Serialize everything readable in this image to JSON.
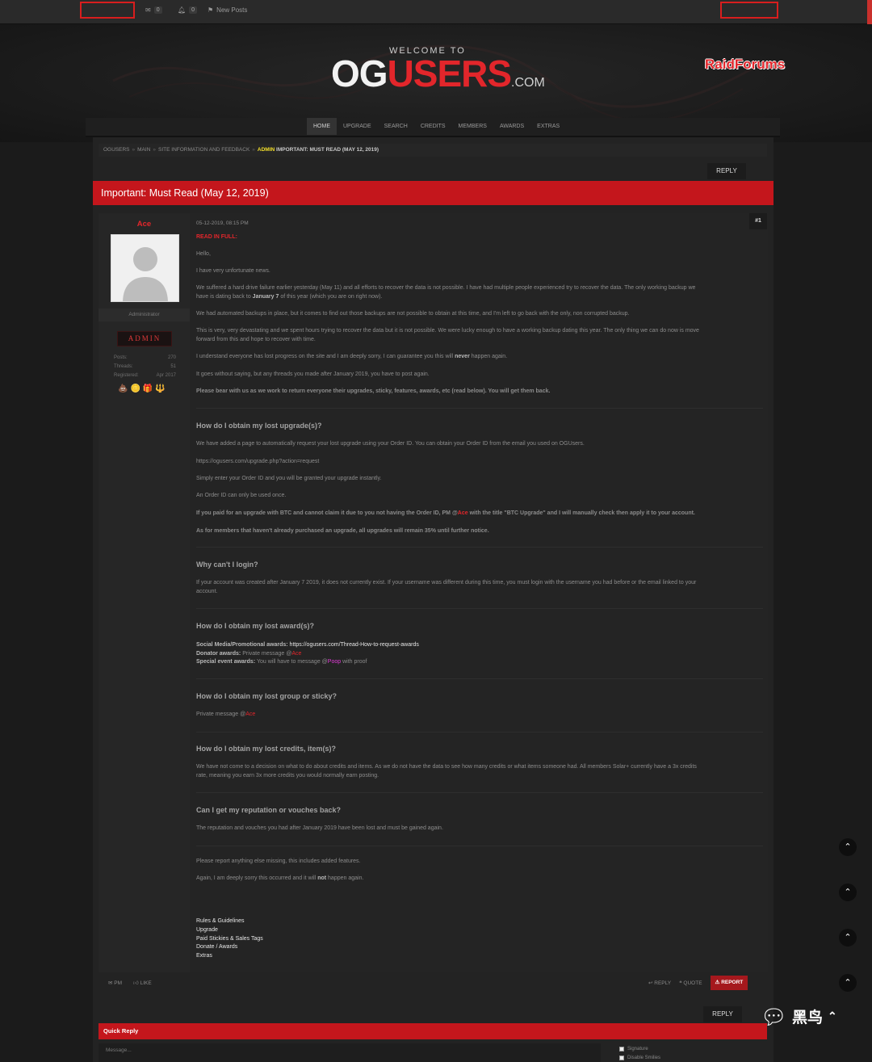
{
  "topbar": {
    "messages_count": "0",
    "alerts_count": "0",
    "new_posts": "New Posts"
  },
  "header": {
    "welcome": "WELCOME TO",
    "logo_og": "OG",
    "logo_users": "USERS",
    "logo_com": ".COM",
    "raidforums": "RaidForums"
  },
  "nav": [
    "HOME",
    "UPGRADE",
    "SEARCH",
    "CREDITS",
    "MEMBERS",
    "AWARDS",
    "EXTRAS"
  ],
  "breadcrumb": {
    "items": [
      "OGUSERS",
      "MAIN",
      "SITE INFORMATION AND FEEDBACK"
    ],
    "admin_tag": "ADMIN",
    "current": "IMPORTANT: MUST READ (MAY 12, 2019)"
  },
  "reply_label": "REPLY",
  "thread_title": "Important: Must Read (May 12, 2019)",
  "user": {
    "name": "Ace",
    "role": "Administrator",
    "badge": "ADMIN",
    "stats": [
      {
        "label": "Posts:",
        "value": "270"
      },
      {
        "label": "Threads:",
        "value": "51"
      },
      {
        "label": "Registered:",
        "value": "Apr 2017"
      }
    ],
    "awards": [
      "💩",
      "🪙",
      "🎁",
      "🔱"
    ]
  },
  "post": {
    "date": "05-12-2019, 08:15 PM",
    "number": "#1",
    "read_full": "READ IN FULL:",
    "p_hello": "Hello,",
    "p_news": "I have very unfortunate news.",
    "p_drive_1": "We suffered a hard drive failure earlier yesterday (May 11) and all efforts to recover the data is not possible. I have had multiple people experienced try to recover the data. The only working backup we",
    "p_drive_2a": "have is dating back to",
    "p_drive_2b": "January 7",
    "p_drive_2c": "of this year (which you are on right now).",
    "p_backups": "We had automated backups in place, but it comes to find out those backups are not possible to obtain at this time, and I'm left to go back with the only, non corrupted backup.",
    "p_devastating_1": "This is very, very devastating and we spent hours trying to recover the data but it is not possible. We were lucky enough to have a working backup dating this year. The only thing we can do now is move",
    "p_devastating_2": "forward from this and hope to recover with time.",
    "p_sorry_a": "I understand everyone has lost progress on the site and I am deeply sorry, I can guarantee you this will",
    "p_sorry_b": "never",
    "p_sorry_c": "happen again.",
    "p_threads": "It goes without saying, but any threads you made after January 2019, you have to post again.",
    "p_bear": "Please bear with us as we work to return everyone their upgrades, sticky, features, awards, etc (read below). You will get them back.",
    "h_upgrade": "How do I obtain my lost upgrade(s)?",
    "p_upgrade_page": "We have added a page to automatically request your lost upgrade using your Order ID. You can obtain your Order ID from the email you used on OGUsers.",
    "p_upgrade_url": "https://ogusers.com/upgrade.php?action=request",
    "p_enter_order": "Simply enter your Order ID and you will be granted your upgrade instantly.",
    "p_order_once": "An Order ID can only be used once.",
    "p_btc_a": "If you paid for an upgrade with BTC and cannot claim it due to you not having the Order ID, PM @",
    "p_btc_user": "Ace",
    "p_btc_b": "with the title \"BTC Upgrade\" and I will manually check then apply it to your account.",
    "p_discount": "As for members that haven't already purchased an upgrade, all upgrades will remain 35% until further notice.",
    "h_login": "Why can't I login?",
    "p_login_1": "If your account was created after January 7 2019, it does not currently exist. If your username was different during this time, you must login with the username you had before or the email linked to your",
    "p_login_2": "account.",
    "h_award": "How do I obtain my lost award(s)?",
    "p_award_social_label": "Social Media/Promotional awards:",
    "p_award_social_url": "https://ogusers.com/Thread-How-to-request-awards",
    "p_award_donator_label": "Donator awards:",
    "p_award_donator_text": "Private message @",
    "p_award_donator_user": "Ace",
    "p_award_special_label": "Special event awards:",
    "p_award_special_text": "You will have to message @",
    "p_award_special_user": "Poop",
    "p_award_special_tail": "with proof",
    "h_group": "How do I obtain my lost group or sticky?",
    "p_group_text": "Private message @",
    "p_group_user": "Ace",
    "h_credits": "How do I obtain my lost credits, item(s)?",
    "p_credits_1": "We have not come to a decision on what to do about credits and items. As we do not have the data to see how many credits or what items someone had. All members Solar+ currently have a 3x credits",
    "p_credits_2": "rate, meaning you earn 3x more credits you would normally earn posting.",
    "h_reputation": "Can I get my reputation or vouches back?",
    "p_reputation": "The reputation and vouches you had after January 2019 have been lost and must be gained again.",
    "p_report": "Please report anything else missing, this includes added features.",
    "p_again_a": "Again, I am deeply sorry this occurred and it will",
    "p_again_b": "not",
    "p_again_c": "happen again.",
    "links": [
      "Rules & Guidelines",
      "Upgrade",
      "Paid Stickies & Sales Tags",
      "Donate / Awards",
      "Extras"
    ]
  },
  "post_footer": {
    "pm": "PM",
    "like": "LIKE",
    "reply": "REPLY",
    "quote": "QUOTE",
    "report": "REPORT"
  },
  "quick_reply": {
    "title": "Quick Reply",
    "placeholder": "Message...",
    "opt_signature": "Signature",
    "opt_smilies": "Disable Smilies"
  },
  "watermark": {
    "name": "黑鸟"
  },
  "colors": {
    "accent": "#c4161c",
    "link_red": "#e3262b",
    "mention_magenta": "#e23bd8",
    "admin_yellow": "#f4e02b"
  }
}
